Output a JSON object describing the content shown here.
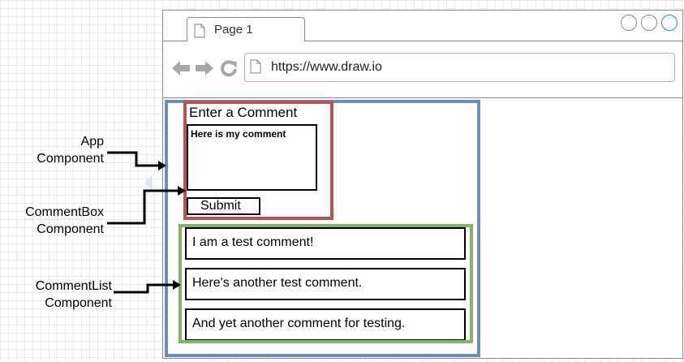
{
  "browser": {
    "tab_label": "Page 1",
    "url": "https://www.draw.io",
    "icons": [
      "page-icon",
      "back-arrow-icon",
      "forward-arrow-icon",
      "reload-icon"
    ]
  },
  "comment_box": {
    "heading": "Enter a Comment",
    "textarea_value": "Here is my comment",
    "submit_label": "Submit"
  },
  "comments": [
    "I am a test comment!",
    "Here's another test comment.",
    "And yet another comment for testing."
  ],
  "labels": {
    "app": [
      "App",
      "Component"
    ],
    "comment_box": [
      "CommentBox",
      "Component"
    ],
    "comment_list": [
      "CommentList",
      "Component"
    ]
  },
  "colors": {
    "app": "#6c8ebf",
    "comment_box": "#b85450",
    "comment_list": "#82b366",
    "window_accent": "#1e88e5"
  }
}
